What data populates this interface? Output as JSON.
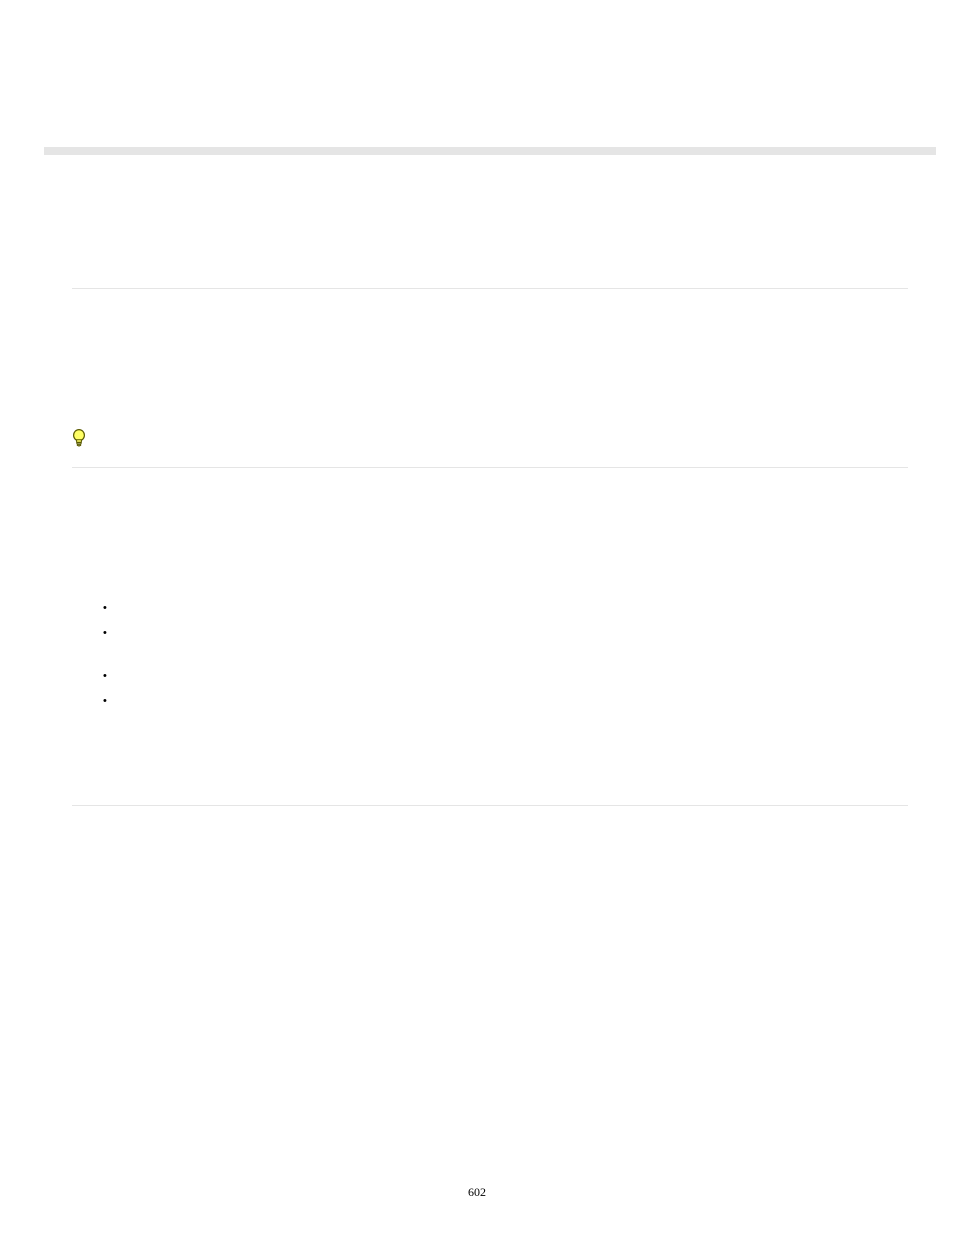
{
  "page": {
    "number": "602"
  },
  "bullets": [
    "",
    "",
    "",
    ""
  ]
}
